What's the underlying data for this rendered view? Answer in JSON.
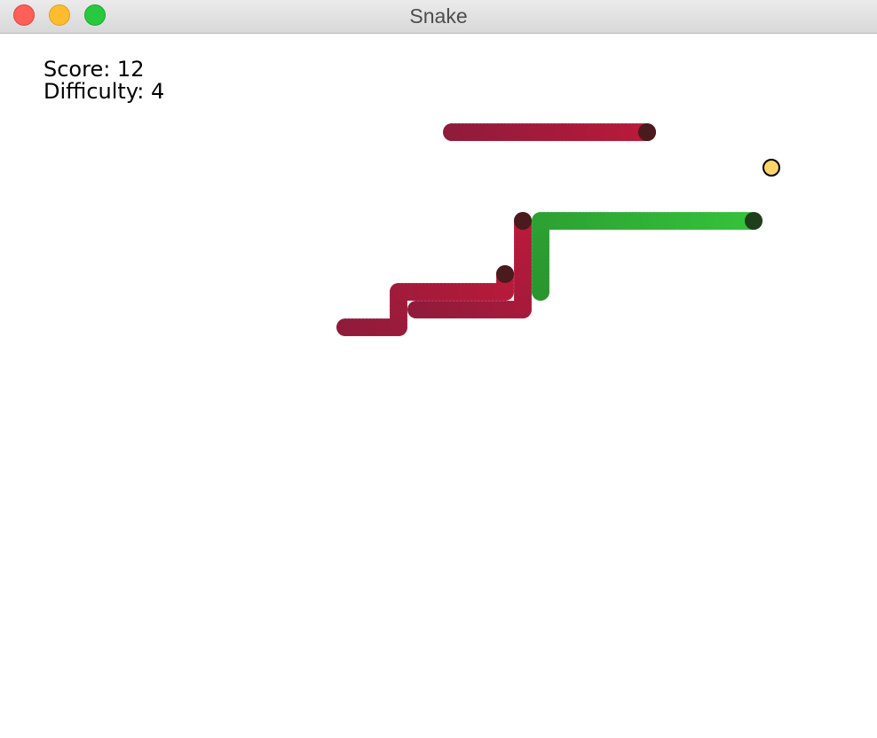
{
  "window": {
    "title": "Snake",
    "controls": [
      "close",
      "minimize",
      "zoom"
    ]
  },
  "hud": {
    "score_label": "Score: 12",
    "difficulty_label": "Difficulty: 4"
  },
  "game": {
    "score": 12,
    "difficulty": 4,
    "food": {
      "color": "#ffd56b"
    },
    "snakes": [
      {
        "id": "red-snake-1",
        "head_color": "#4a1a1c",
        "tail_color": "#8f1b3b",
        "head_end_color": "#b81a3a"
      },
      {
        "id": "red-snake-2",
        "head_color": "#4a1a1c",
        "tail_color": "#8f1b3b",
        "head_end_color": "#b81a3a"
      },
      {
        "id": "red-snake-3",
        "head_color": "#4a1a1c",
        "tail_color": "#8f1b3b",
        "head_end_color": "#b81a3a"
      },
      {
        "id": "green-snake",
        "head_color": "#1e3e1c",
        "tail_color": "#2a952f",
        "head_end_color": "#34c23a"
      }
    ]
  }
}
